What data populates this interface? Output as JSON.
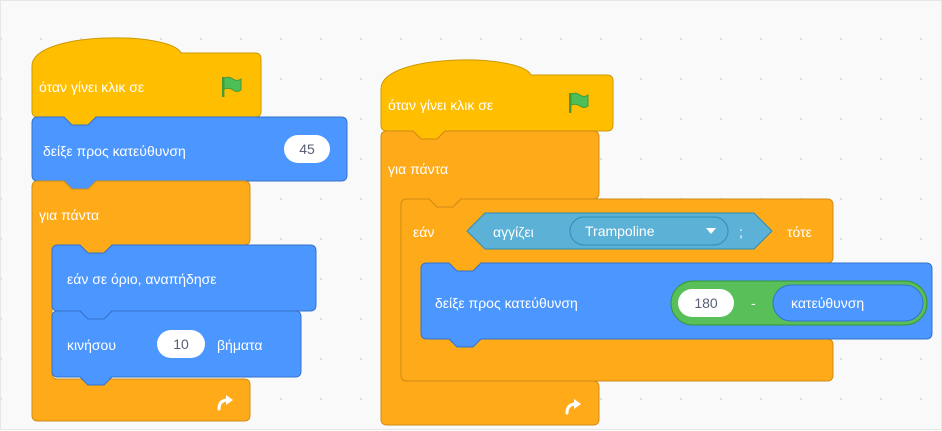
{
  "colors": {
    "events": "#FFBF00",
    "events_border": "#CC9900",
    "control": "#FFAB19",
    "control_border": "#CF8B17",
    "motion": "#4C97FF",
    "motion_border": "#3373CC",
    "sensing": "#5CB1D6",
    "sensing_border": "#2E8EB8",
    "operators": "#59C059",
    "operators_border": "#389438",
    "workspace": "#F9F9F9"
  },
  "script1": {
    "hat_label": "όταν γίνει κλικ σε",
    "hat_icon": "green-flag-icon",
    "point_label": "δείξε προς κατεύθυνση",
    "point_value": "45",
    "forever_label": "για πάντα",
    "bounce_label": "εάν σε όριο, αναπήδησε",
    "move_label": "κινήσου",
    "move_value": "10",
    "move_unit": "βήματα",
    "loop_icon": "loop-arrow-icon"
  },
  "script2": {
    "hat_label": "όταν γίνει κλικ σε",
    "hat_icon": "green-flag-icon",
    "forever_label": "για πάντα",
    "if_label": "εάν",
    "then_label": "τότε",
    "touching_label": "αγγίζει",
    "touching_value": "Trampoline",
    "touching_suffix": ";",
    "point_label": "δείξε προς κατεύθυνση",
    "minus_left": "180",
    "minus_op": "-",
    "direction_reporter": "κατεύθυνση",
    "loop_icon": "loop-arrow-icon"
  }
}
